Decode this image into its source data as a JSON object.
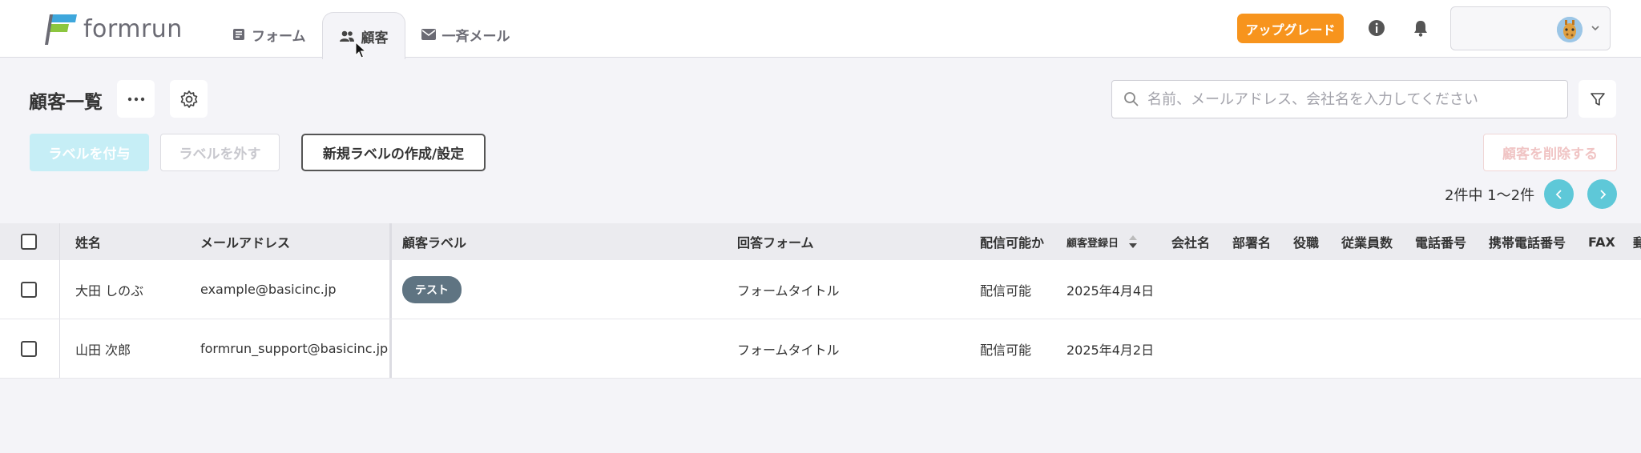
{
  "app": {
    "logo_text": "formrun"
  },
  "nav": {
    "forms": "フォーム",
    "customers": "顧客",
    "bulk_mail": "一斉メール"
  },
  "header": {
    "upgrade_label": "アップグレード"
  },
  "toolbar": {
    "title": "顧客一覧",
    "search_placeholder": "名前、メールアドレス、会社名を入力してください",
    "add_label": "ラベルを付与",
    "remove_label": "ラベルを外す",
    "new_label": "新規ラベルの作成/設定",
    "delete_label": "顧客を削除する"
  },
  "pagination": {
    "count_text": "2件中 1〜2件"
  },
  "table": {
    "columns": {
      "name": "姓名",
      "email": "メールアドレス",
      "label": "顧客ラベル",
      "form": "回答フォーム",
      "delivery": "配信可能か",
      "registered": "顧客登録日",
      "company": "会社名",
      "department": "部署名",
      "position": "役職",
      "employees": "従業員数",
      "phone": "電話番号",
      "mobile": "携帯電話番号",
      "fax": "FAX",
      "more": "郵"
    },
    "rows": [
      {
        "name": "大田 しのぶ",
        "email": "example@basicinc.jp",
        "label": "テスト",
        "form": "フォームタイトル",
        "delivery": "配信可能",
        "registered": "2025年4月4日"
      },
      {
        "name": "山田 次郎",
        "email": "formrun_support@basicinc.jp",
        "label": "",
        "form": "フォームタイトル",
        "delivery": "配信可能",
        "registered": "2025年4月2日"
      }
    ]
  },
  "colors": {
    "upgrade": "#f7941d",
    "pagination": "#5ec8d8",
    "tag": "#5f7482",
    "add_disabled": "#c6eef6"
  }
}
